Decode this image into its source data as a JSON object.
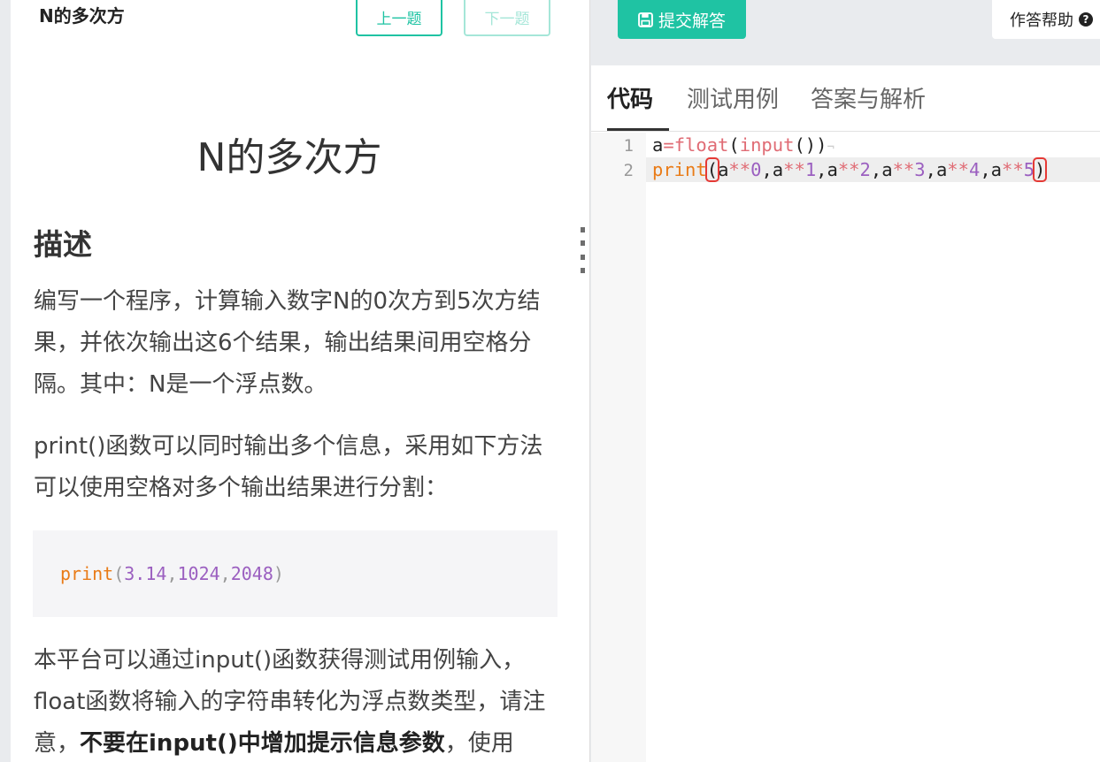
{
  "header": {
    "problem_short_title": "N的多次方",
    "prev_label": "上一题",
    "next_label": "下一题"
  },
  "problem": {
    "title": "N的多次方",
    "section_heading": "描述",
    "paragraph1": "编写一个程序，计算输入数字N的0次方到5次方结果，并依次输出这6个结果，输出结果间用空格分隔。其中：N是一个浮点数。",
    "paragraph2": "print()函数可以同时输出多个信息，采用如下方法可以使用空格对多个输出结果进行分割：",
    "example_code": {
      "fn": "print",
      "open": "(",
      "a1": "3.14",
      "sep1": ", ",
      "a2": "1024",
      "sep2": ", ",
      "a3": "2048",
      "close": ")"
    },
    "paragraph3_start": "本平台可以通过input()函数获得测试用例输入，float函数将输入的字符串转化为浮点数类型，请注意，",
    "paragraph3_bold": "不要在input()中增加提示信息参数",
    "paragraph3_end": "，使用"
  },
  "toolbar": {
    "submit_label": "提交解答",
    "submit_icon": "save-icon",
    "help_label": "作答帮助",
    "help_icon": "question-circle-icon"
  },
  "tabs": [
    {
      "label": "代码",
      "active": true
    },
    {
      "label": "测试用例",
      "active": false
    },
    {
      "label": "答案与解析",
      "active": false
    }
  ],
  "editor": {
    "line_numbers": [
      "1",
      "2"
    ],
    "line1": {
      "t1": "a",
      "t2": "=",
      "t3": "float",
      "t4": "(",
      "t5": "input",
      "t6": "())",
      "eol": "¬"
    },
    "line2": {
      "t1": "print",
      "t2": "(",
      "t3": "a",
      "t4": "**",
      "t5": "0",
      "t6": ",",
      "t7": "a",
      "t8": "**",
      "t9": "1",
      "t10": ",",
      "t11": "a",
      "t12": "**",
      "t13": "2",
      "t14": ",",
      "t15": "a",
      "t16": "**",
      "t17": "3",
      "t18": ",",
      "t19": "a",
      "t20": "**",
      "t21": "4",
      "t22": ",",
      "t23": "a",
      "t24": "**",
      "t25": "5",
      "t26": ")"
    }
  },
  "colors": {
    "accent": "#1fc3a3",
    "print_keyword": "#e97b17",
    "number": "#9b5fc0",
    "operator": "#e06c75",
    "bracket_match": "#e53935"
  }
}
